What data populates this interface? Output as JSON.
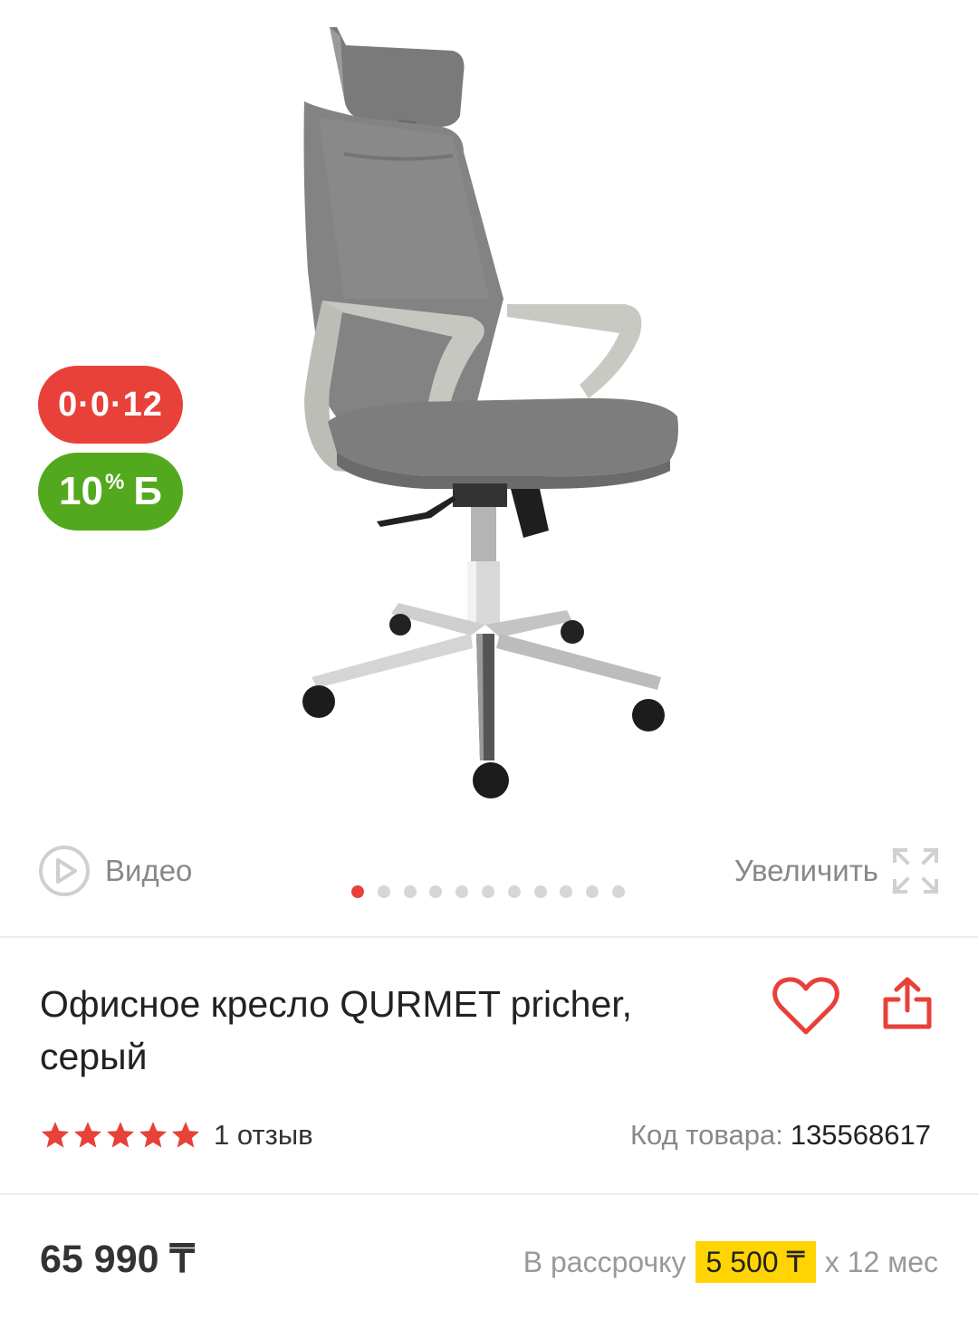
{
  "gallery": {
    "badges": {
      "installment": "0·0·12",
      "bonus_value": "10",
      "bonus_percent": "%",
      "bonus_currency": "Б"
    },
    "video_label": "Видео",
    "zoom_label": "Увеличить",
    "slide_count": 11,
    "active_slide": 1
  },
  "product": {
    "title": "Офисное кресло QURMET pricher, серый",
    "rating_stars": 5,
    "reviews": "1 отзыв",
    "sku_label": "Код товара:",
    "sku_value": "135568617"
  },
  "pricing": {
    "price": "65 990 ₸",
    "installment_prefix": "В рассрочку",
    "installment_amount": "5 500 ₸",
    "installment_suffix": "х 12 мес"
  },
  "colors": {
    "accent": "#e8413a",
    "bonus": "#52a91e",
    "installment_highlight": "#ffd400"
  }
}
